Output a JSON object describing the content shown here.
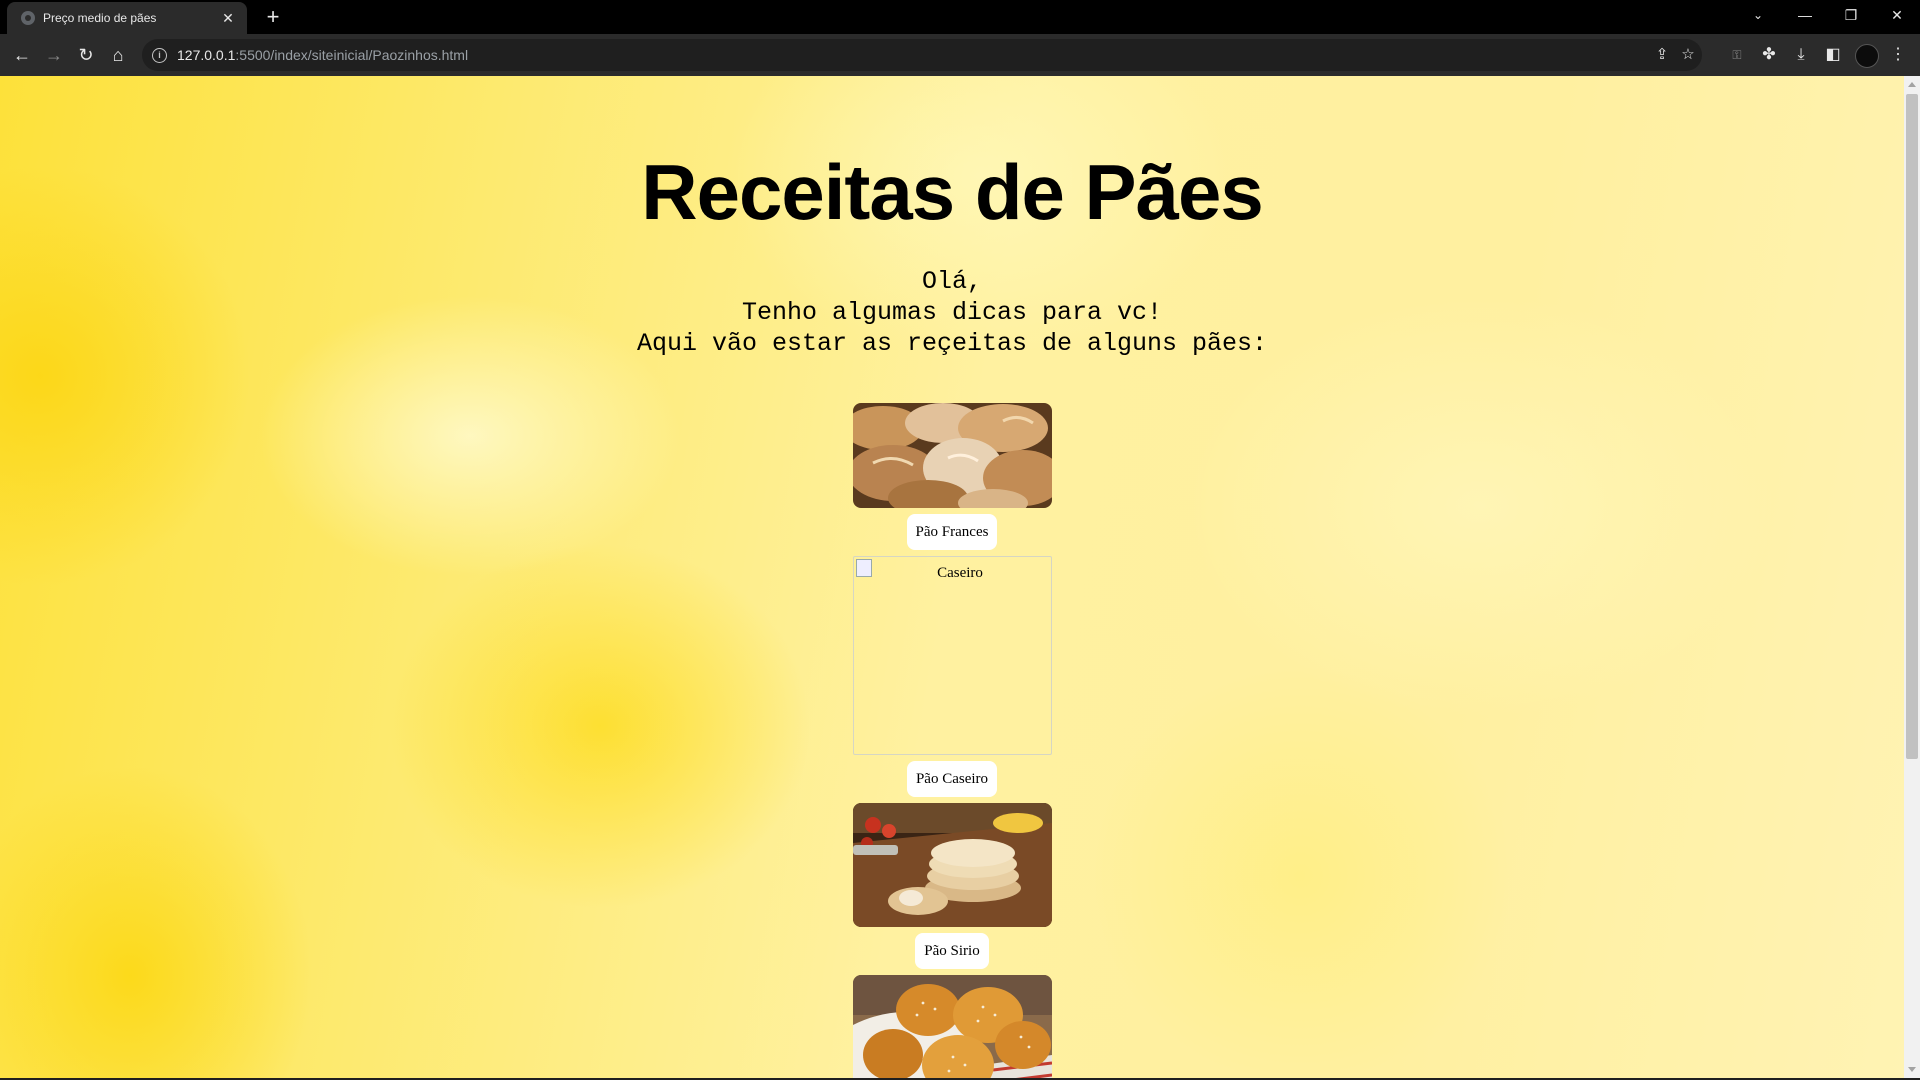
{
  "browser": {
    "tab_title": "Preço medio de pães",
    "url_host": "127.0.0.1",
    "url_path": ":5500/index/siteinicial/Paozinhos.html"
  },
  "page": {
    "title": "Receitas de Pães",
    "intro_lines": [
      "Olá,",
      "Tenho algumas dicas para vc!",
      "Aqui vão estar as reçeitas de alguns pães:"
    ],
    "breads": [
      {
        "label": "Pão Frances"
      },
      {
        "label": "Pão Caseiro",
        "image_alt": "Caseiro"
      },
      {
        "label": "Pão Sirio"
      },
      {
        "label": ""
      }
    ]
  },
  "colors": {
    "background_yellow": "#fde13a",
    "chip_background": "#ffffff"
  }
}
